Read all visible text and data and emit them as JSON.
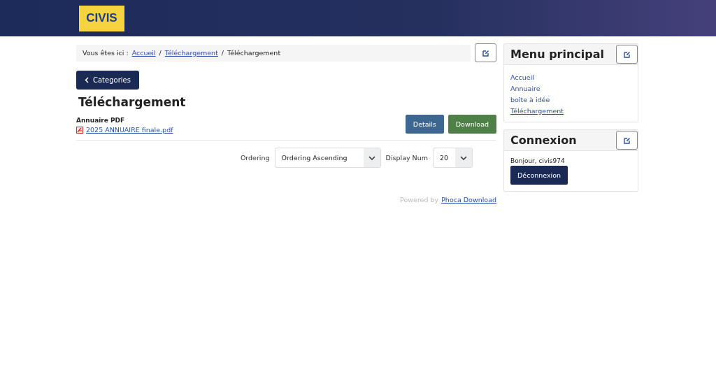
{
  "header": {
    "logo": "CIVIS"
  },
  "breadcrumb": {
    "label": "Vous êtes ici :",
    "items": [
      {
        "text": "Accueil",
        "link": true
      },
      {
        "text": "Téléchargement",
        "link": true
      },
      {
        "text": "Téléchargement",
        "link": false
      }
    ],
    "separator": "/"
  },
  "back_button": "Categories",
  "title": "Téléchargement",
  "file": {
    "category": "Annuaire PDF",
    "name": "2025 ANNUAIRE finale.pdf",
    "buttons": [
      {
        "label": "Details",
        "kind": "details"
      },
      {
        "label": "Download",
        "kind": "download"
      }
    ]
  },
  "filters": [
    {
      "label": "Ordering",
      "value": "Ordering Ascending",
      "kind": "wide"
    },
    {
      "label": "Display Num",
      "value": "20",
      "kind": "narrow"
    }
  ],
  "powered": {
    "text": "Powered by",
    "link": "Phoca Download"
  },
  "sidebar": [
    {
      "title": "Menu principal",
      "kind": "menu",
      "items": [
        {
          "label": "Accueil",
          "selected": false
        },
        {
          "label": "Annuaire",
          "selected": false
        },
        {
          "label": "boîte à idée",
          "selected": false
        },
        {
          "label": "Téléchargement",
          "selected": true
        }
      ]
    },
    {
      "title": "Connexion",
      "kind": "login",
      "greeting": "Bonjour, civis974",
      "button": "Déconnexion"
    }
  ]
}
